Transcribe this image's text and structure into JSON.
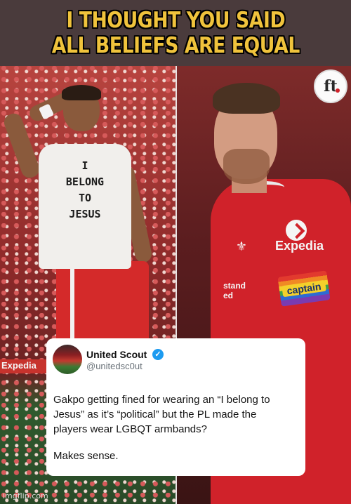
{
  "meme": {
    "caption_lines": [
      "I THOUGHT YOU SAID",
      "ALL BELIEFS ARE EQUAL"
    ],
    "caption_color": "#f0c33c"
  },
  "left_photo": {
    "shirt_lines": [
      "I",
      "BELONG",
      "TO",
      "JESUS"
    ],
    "ad_board_text": "Expedia"
  },
  "right_photo": {
    "sponsor_text": "Expedia",
    "armband_text": "captain",
    "sleeve_lines": [
      "stand",
      "ed"
    ],
    "corner_logo_text": "ft"
  },
  "tweet": {
    "display_name": "United Scout",
    "handle": "@unitedsc0ut",
    "verified_icon": "✓",
    "lines": [
      "Gakpo getting fined for wearing an “I belong to",
      "Jesus” as it’s “political” but the PL made the",
      "players wear LGBQT armbands?"
    ],
    "closing": "Makes sense."
  },
  "watermark": "imgflip.com"
}
